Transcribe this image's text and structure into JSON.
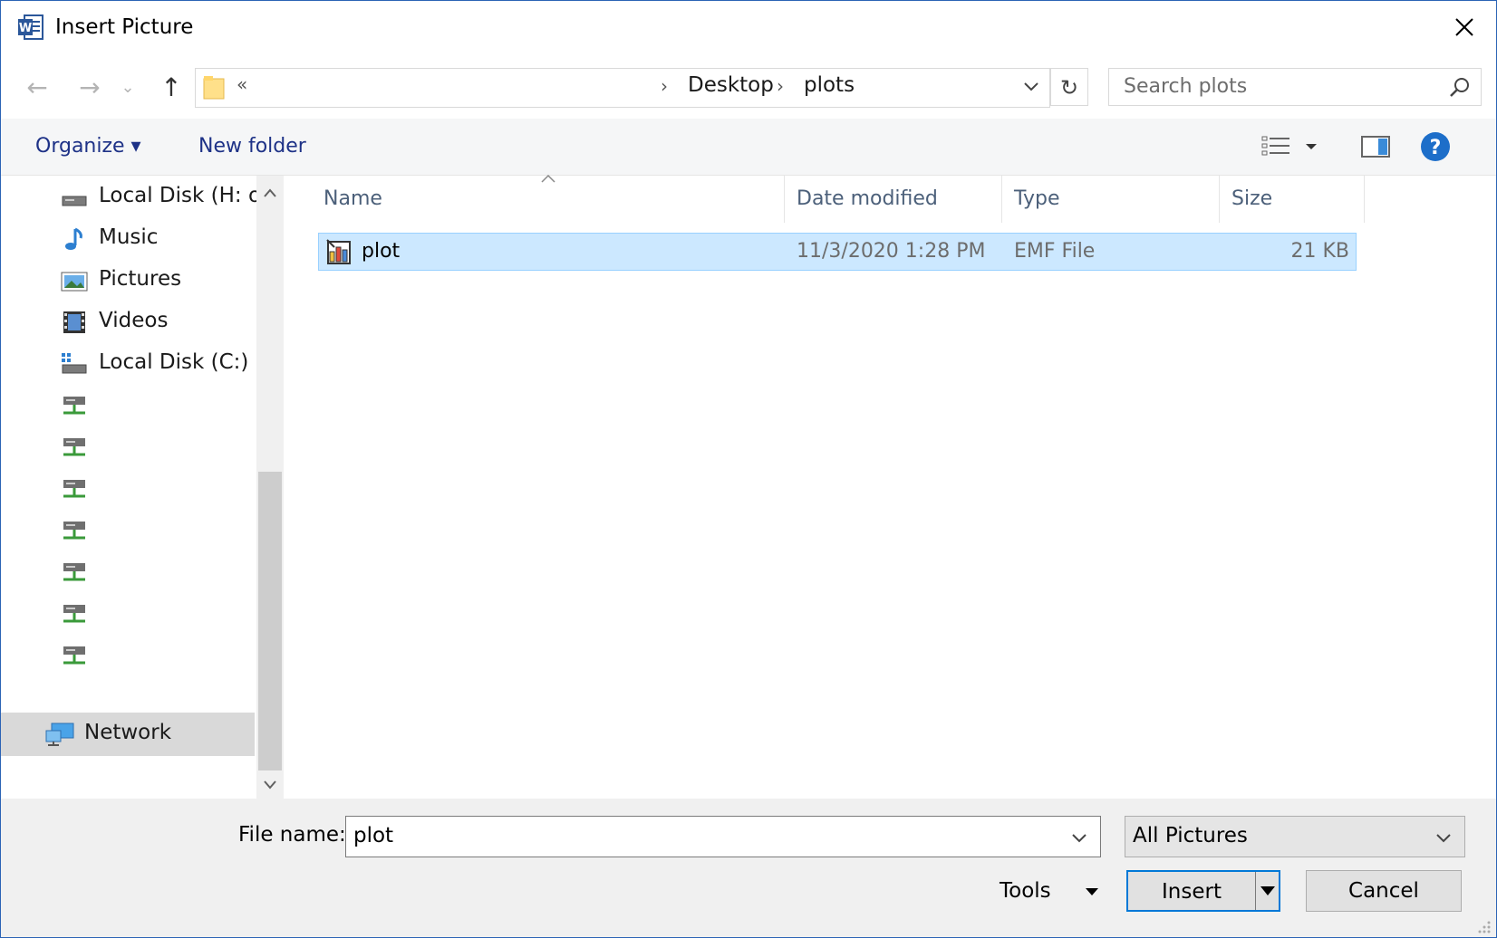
{
  "window": {
    "title": "Insert Picture",
    "app_icon": "word-icon"
  },
  "nav": {
    "back": "←",
    "forward": "→",
    "recent": "⌄",
    "up": "↑",
    "address": {
      "root": "«",
      "crumbs": [
        "Desktop",
        "plots"
      ],
      "separator": "›"
    },
    "refresh": "↻",
    "search_placeholder": "Search plots"
  },
  "commands": {
    "organize": "Organize ▾",
    "new_folder": "New folder"
  },
  "sidebar": {
    "items": [
      {
        "label": "Local Disk (H: or",
        "icon": "drive-icon"
      },
      {
        "label": "Music",
        "icon": "music-icon"
      },
      {
        "label": "Pictures",
        "icon": "pictures-icon"
      },
      {
        "label": "Videos",
        "icon": "videos-icon"
      },
      {
        "label": "Local Disk (C:)",
        "icon": "local-disk-icon"
      },
      {
        "label": "",
        "icon": "network-drive-icon"
      },
      {
        "label": "",
        "icon": "network-drive-icon"
      },
      {
        "label": "",
        "icon": "network-drive-icon"
      },
      {
        "label": "",
        "icon": "network-drive-icon"
      },
      {
        "label": "",
        "icon": "network-drive-icon"
      },
      {
        "label": "",
        "icon": "network-drive-icon"
      },
      {
        "label": "",
        "icon": "network-drive-icon"
      }
    ],
    "network": "Network"
  },
  "columns": {
    "name": "Name",
    "date": "Date modified",
    "type": "Type",
    "size": "Size"
  },
  "files": [
    {
      "name": "plot",
      "date": "11/3/2020 1:28 PM",
      "type": "EMF File",
      "size": "21 KB",
      "selected": true
    }
  ],
  "footer": {
    "file_name_label": "File name:",
    "file_name_value": "plot",
    "file_type_value": "All Pictures",
    "tools": "Tools",
    "insert": "Insert",
    "cancel": "Cancel"
  },
  "colors": {
    "accent": "#0078d7",
    "selection": "#cce8ff",
    "link": "#1e3287"
  }
}
